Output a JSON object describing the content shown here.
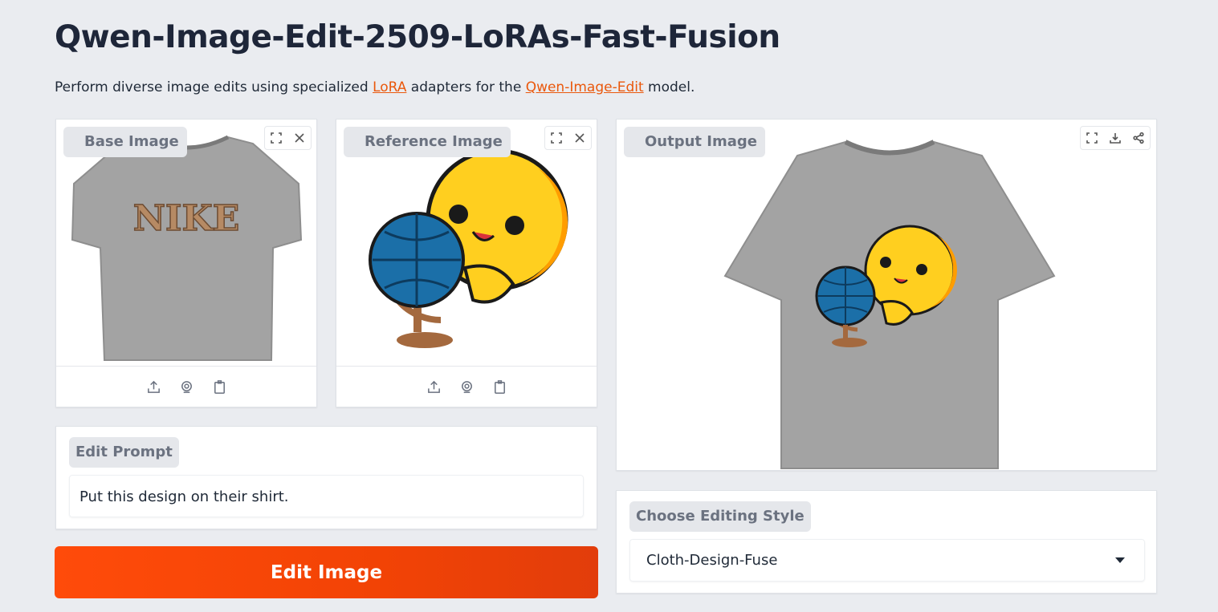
{
  "header": {
    "title": "Qwen-Image-Edit-2509-LoRAs-Fast-Fusion",
    "desc_prefix": "Perform diverse image edits using specialized ",
    "lora_link": "LoRA",
    "desc_mid": " adapters for the ",
    "model_link": "Qwen-Image-Edit",
    "desc_suffix": " model."
  },
  "base_image": {
    "label": "Base Image",
    "shirt_text": "NIKE"
  },
  "reference_image": {
    "label": "Reference Image"
  },
  "output_image": {
    "label": "Output Image"
  },
  "prompt": {
    "label": "Edit Prompt",
    "value": "Put this design on their shirt."
  },
  "edit_button": {
    "label": "Edit Image"
  },
  "style": {
    "label": "Choose Editing Style",
    "selected": "Cloth-Design-Fuse"
  },
  "icons": [
    "fullscreen-icon",
    "close-icon",
    "download-icon",
    "share-icon",
    "upload-icon",
    "webcam-icon",
    "clipboard-icon",
    "chevron-down-icon"
  ],
  "colors": {
    "accent": "#f24305",
    "link": "#ea580c",
    "background": "#eaecf0",
    "shirt": "#a3a3a3"
  }
}
